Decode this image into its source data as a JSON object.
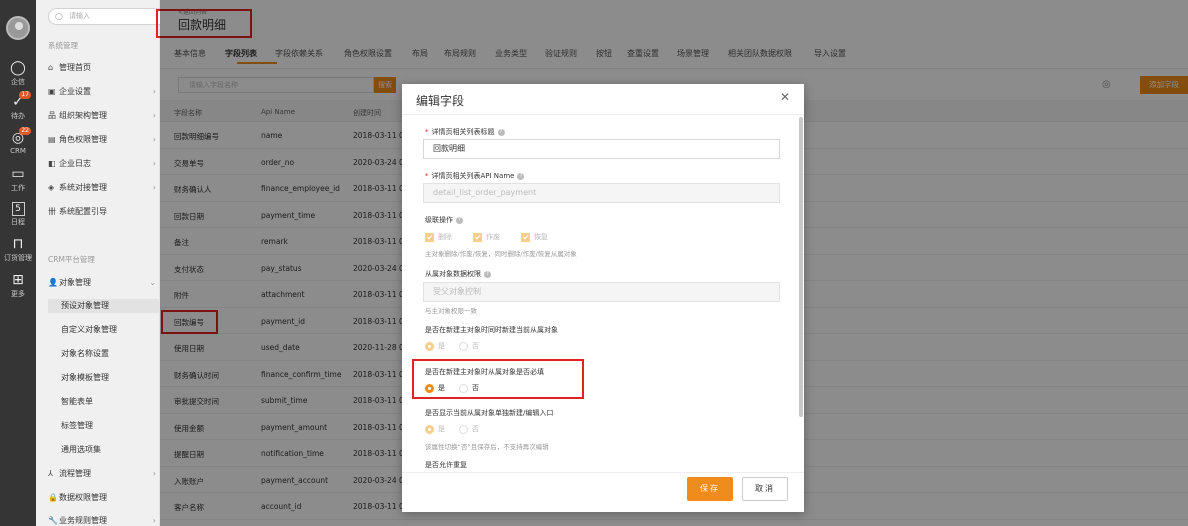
{
  "rail": {
    "items": [
      {
        "label": "企信",
        "icon": "chat-bubble-icon",
        "glyph": "◯"
      },
      {
        "label": "待办",
        "icon": "todo-check-icon",
        "glyph": "✓",
        "badge": "17"
      },
      {
        "label": "CRM",
        "icon": "crm-icon",
        "glyph": "◎",
        "badge": "22"
      },
      {
        "label": "工作",
        "icon": "work-calendar-icon",
        "glyph": "▭"
      },
      {
        "label": "日程",
        "icon": "schedule-icon",
        "glyph": "5"
      },
      {
        "label": "订货管理",
        "icon": "order-icon",
        "glyph": "⊓"
      },
      {
        "label": "更多",
        "icon": "more-grid-icon",
        "glyph": "⊞"
      }
    ]
  },
  "sidebar": {
    "search_placeholder": "请输入",
    "group1": "系统管理",
    "items1": [
      {
        "label": "管理首页",
        "glyph": "⌂"
      },
      {
        "label": "企业设置",
        "glyph": "▣"
      },
      {
        "label": "组织架构管理",
        "glyph": "品"
      },
      {
        "label": "角色权限管理",
        "glyph": "▤"
      },
      {
        "label": "企业日志",
        "glyph": "◧"
      },
      {
        "label": "系统对接管理",
        "glyph": "◈"
      },
      {
        "label": "系统配置引导",
        "glyph": "卌"
      }
    ],
    "group2": "CRM平台管理",
    "object_mgmt": "对象管理",
    "subitems": [
      "预设对象管理",
      "自定义对象管理",
      "对象名称设置",
      "对象模板管理",
      "智能表单",
      "标签管理",
      "通用选项集"
    ],
    "items2": [
      {
        "label": "流程管理",
        "glyph": "⅄"
      },
      {
        "label": "数据权限管理",
        "glyph": "🔒"
      },
      {
        "label": "业务规则管理",
        "glyph": "🔧"
      }
    ]
  },
  "header": {
    "breadcrumb": "<返回列表",
    "title": "回款明细"
  },
  "tabs": [
    "基本信息",
    "字段列表",
    "字段依赖关系",
    "角色权限设置",
    "布局",
    "布局规则",
    "业务类型",
    "验证规则",
    "按钮",
    "查重设置",
    "场景管理",
    "相关团队数据权限",
    "导入设置"
  ],
  "toolbar": {
    "search_placeholder": "请输入字段名称",
    "search_button": "搜索",
    "add_button": "添加字段"
  },
  "table": {
    "columns": [
      "字段名称",
      "Api Name",
      "创建时间"
    ],
    "rows": [
      [
        "回款明细编号",
        "name",
        "2018-03-11 06"
      ],
      [
        "交易单号",
        "order_no",
        "2020-03-24 0"
      ],
      [
        "财务确认人",
        "finance_employee_id",
        "2018-03-11 06"
      ],
      [
        "回款日期",
        "payment_time",
        "2018-03-11 06"
      ],
      [
        "备注",
        "remark",
        "2018-03-11 06"
      ],
      [
        "支付状态",
        "pay_status",
        "2020-03-24 0"
      ],
      [
        "附件",
        "attachment",
        "2018-03-11 06"
      ],
      [
        "回款编号",
        "payment_id",
        "2018-03-11 06"
      ],
      [
        "使用日期",
        "used_date",
        "2020-11-28 0"
      ],
      [
        "财务确认时间",
        "finance_confirm_time",
        "2018-03-11 06"
      ],
      [
        "审批提交时间",
        "submit_time",
        "2018-03-11 06"
      ],
      [
        "使用金额",
        "payment_amount",
        "2018-03-11 06"
      ],
      [
        "提醒日期",
        "notification_time",
        "2018-03-11 06"
      ],
      [
        "入账账户",
        "payment_account",
        "2020-03-24 0"
      ],
      [
        "客户名称",
        "account_id",
        "2018-03-11 06:38"
      ]
    ]
  },
  "dialog": {
    "title": "编辑字段",
    "close": "✕",
    "f1_label": "详情页相关列表标题",
    "f1_value": "回款明细",
    "f2_label": "详情页相关列表API Name",
    "f2_value": "detail_list_order_payment",
    "f3_label": "级联操作",
    "cascade": [
      "删除",
      "作废",
      "恢复"
    ],
    "f3_hint": "主对象删除/作废/恢复，同时删除/作废/恢复从属对象",
    "f4_label": "从属对象数据权限",
    "f4_value": "受父对象控制",
    "f4_hint": "与主对象权限一致",
    "f5_label": "是否在新建主对象时同时新建当前从属对象",
    "f6_label": "是否在新建主对象时从属对象是否必填",
    "f7_label": "是否显示当前从属对象单独新建/编辑入口",
    "f7_hint": "该属性切换“否”且保存后，不支持再次编辑",
    "f8_label": "是否允许重复",
    "yes": "是",
    "no": "否",
    "save": "保存",
    "cancel": "取消"
  }
}
